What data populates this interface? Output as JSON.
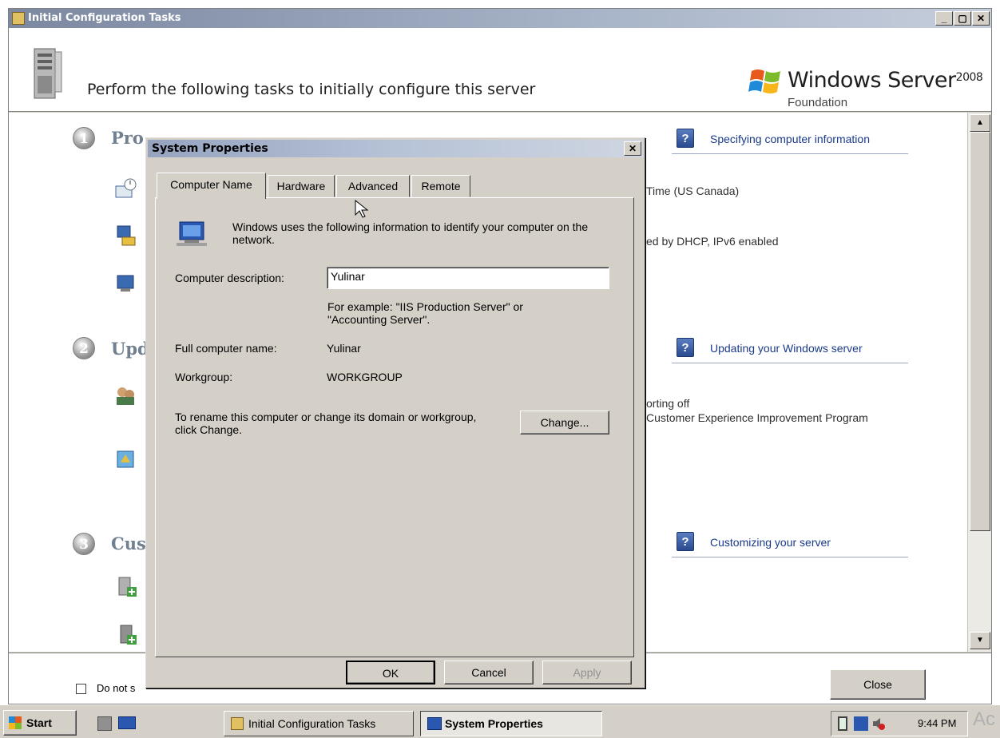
{
  "main_window": {
    "title": "Initial Configuration Tasks",
    "header_text": "Perform the following tasks to initially configure this server",
    "brand": {
      "name": "Windows Server",
      "year": "2008",
      "edition": "Foundation"
    }
  },
  "steps": [
    {
      "number": "1",
      "title": "Provide Computer Information",
      "visible_title": "Pro"
    },
    {
      "number": "2",
      "title": "Upd",
      "visible_title": "Upd"
    },
    {
      "number": "3",
      "title": "Cus",
      "visible_title": "Cus"
    }
  ],
  "help_links": [
    "Specifying computer information",
    "Updating your Windows server",
    "Customizing your server"
  ],
  "right_info": {
    "timezone": "Time (US  Canada)",
    "network": "ed by DHCP, IPv6 enabled",
    "reporting_1": "orting off",
    "reporting_2": "Customer Experience Improvement Program"
  },
  "footer": {
    "checkbox_label": "Do not s",
    "close_label": "Close"
  },
  "dialog": {
    "title": "System Properties",
    "tabs": [
      "Computer Name",
      "Hardware",
      "Advanced",
      "Remote"
    ],
    "intro": "Windows uses the following information to identify your computer on the network.",
    "description_label": "Computer description:",
    "description_value": "Yulinar",
    "example_text": "For example: \"IIS Production Server\" or \"Accounting Server\".",
    "full_name_label": "Full computer name:",
    "full_name_value": "Yulinar",
    "workgroup_label": "Workgroup:",
    "workgroup_value": "WORKGROUP",
    "rename_text": "To rename this computer or change its domain or workgroup, click Change.",
    "change_button": "Change...",
    "ok_button": "OK",
    "cancel_button": "Cancel",
    "apply_button": "Apply"
  },
  "taskbar": {
    "start_label": "Start",
    "tasks": [
      "Initial Configuration Tasks",
      "System Properties"
    ],
    "clock": "9:44 PM",
    "edge_text": "Ac"
  }
}
